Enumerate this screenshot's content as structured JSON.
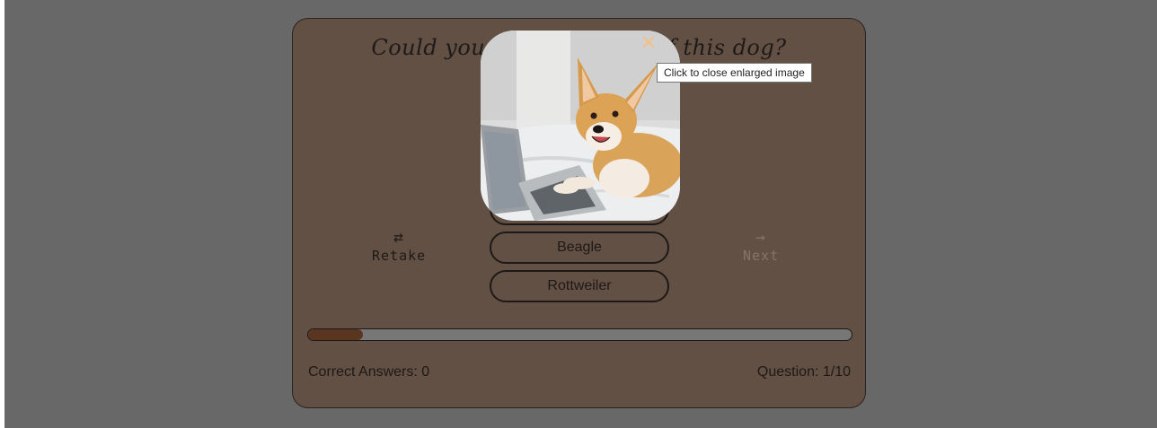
{
  "quiz": {
    "question": "Could you tell the breed of this dog?",
    "answers": [
      "Beagle",
      "Rottweiler"
    ],
    "retake_label": "Retake",
    "retake_icon": "repeat-icon",
    "next_label": "Next",
    "next_icon": "arrow-right-icon",
    "progress_fraction": 0.1,
    "correct_answers": "Correct Answers: 0",
    "question_counter": "Question: 1/10"
  },
  "image_popup": {
    "close_icon": "close-icon",
    "tooltip": "Click to close enlarged image",
    "subject": "corgi-dog-photo"
  },
  "colors": {
    "page_overlay": "#686868",
    "card_bg": "#625044",
    "progress_fill": "#5a3520",
    "close_icon": "#f2c08a"
  }
}
